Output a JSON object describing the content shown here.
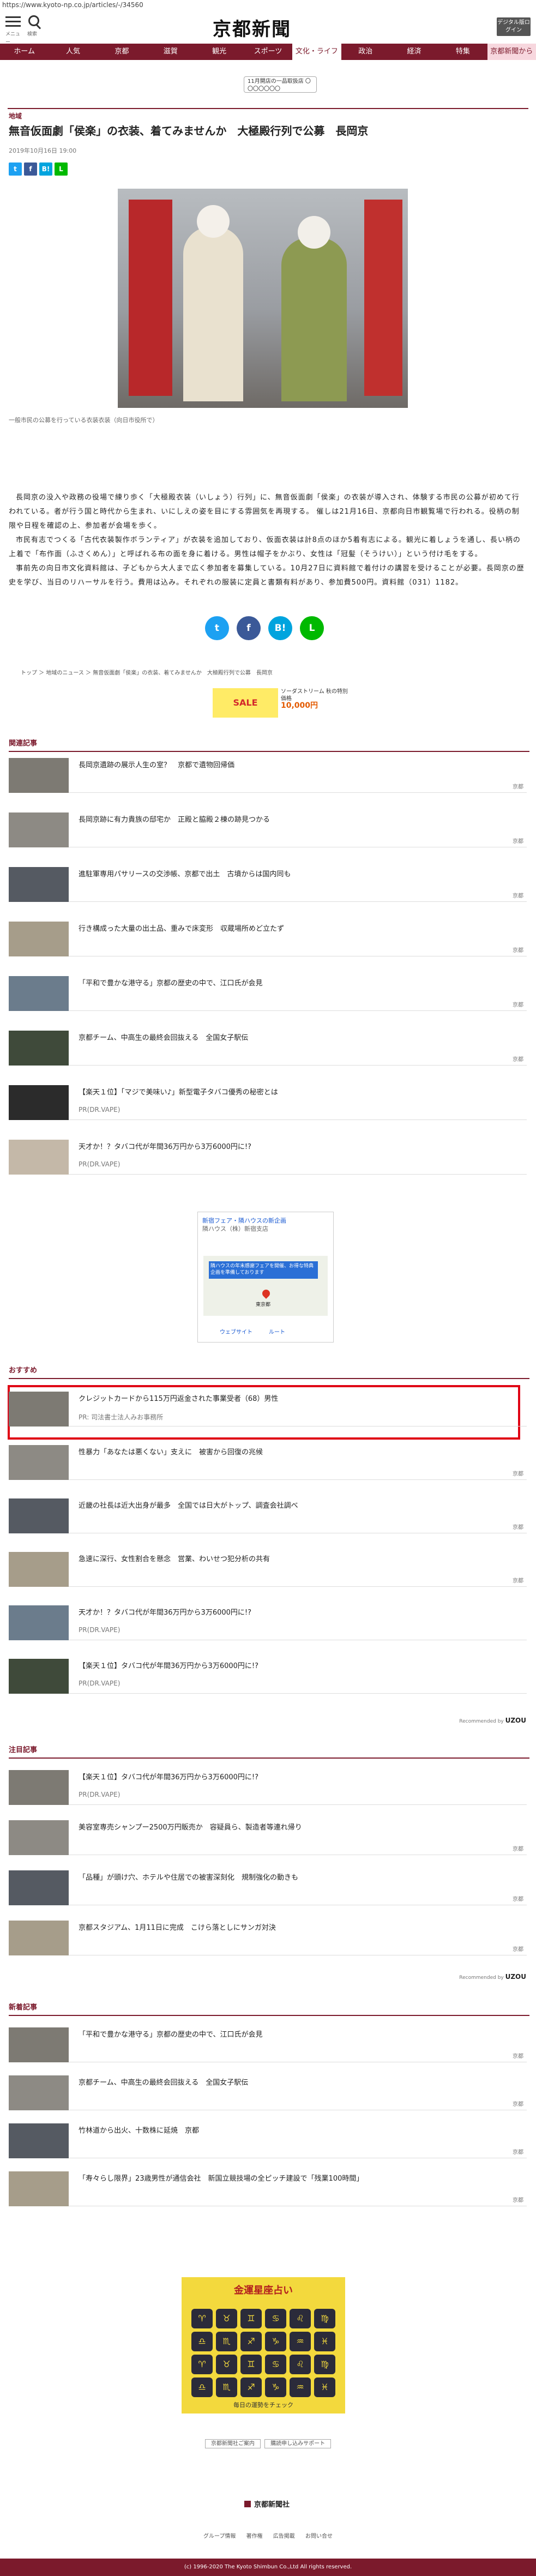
{
  "browser": {
    "url": "https://www.kyoto-np.co.jp/articles/-/34560"
  },
  "header": {
    "menu_label": "メニュー",
    "search_label": "検索",
    "logo": "京都新聞",
    "edition_button": "デジタル版ログイン"
  },
  "nav": [
    "ホーム",
    "人気",
    "京都",
    "滋賀",
    "観光",
    "スポーツ",
    "文化・ライフ",
    "政治",
    "経済",
    "特集",
    "京都新聞から"
  ],
  "banner_ad": "11月開店の一品取扱店 〇〇〇〇〇〇〇",
  "article": {
    "category": "地域",
    "title": "無音仮面劇「侯楽」の衣装、着てみませんか　大極殿行列で公募　長岡京",
    "date": "2019年10月16日 19:00",
    "caption": "一般市民の公募を行っている衣装衣装（向日市役所で）",
    "paragraphs": [
      "長岡京の没入や政務の役場で練り歩く「大極殿衣装（いしょう）行列」に、無音仮面劇「侯楽」の衣装が導入され、体験する市民の公募が初めて行われている。者が行う国と時代から生まれ、いにしえの姿を目にする雰囲気を再現する。  催しは21月16日、京都向日市観覧場で行われる。役柄の制限や日程を確認の上、参加者が会場を歩く。",
      "市民有志でつくる「古代衣装製作ボランティア」が衣装を追加しており、仮面衣装は計8点のほか5着有志による。観光に着しょうを通し、長い柄の上着で「布作面（ふさくめん）」と呼ばれる布の面を身に着ける。男性は帽子をかぶり、女性は「冠髪（そうけい）」という付け毛をする。",
      "事前先の向日市文化資料館は、子どもから大人まで広く参加者を募集している。10月27日に資料館で着付けの講習を受けることが必要。長岡京の歴史を学び、当日のリハーサルを行う。費用は込み。それぞれの服装に定員と書類有料があり、参加費500円。資料館（031）1182。"
    ],
    "breadcrumb": "トップ ＞ 地域のニュース ＞ 無音仮面劇「侯楽」の衣装、着てみませんか　大極殿行列で公募　長岡京"
  },
  "share": {
    "twitter": "t",
    "facebook": "f",
    "hatena": "B!",
    "line": "L"
  },
  "ad_strip": {
    "left": "SALE",
    "right_title": "ソーダストリーム 秋の特別価格",
    "right_price": "10,000円"
  },
  "sections": {
    "related": "関連記事",
    "recommend": "おすすめ",
    "popular": "注目記事",
    "latest": "新着記事"
  },
  "related": [
    {
      "title": "長岡京遺跡の展示人生の室？　京都で遺物回帰価",
      "src": "京都"
    },
    {
      "title": "長岡京跡に有力貴族の邸宅か　正殿と脇殿２棟の跡見つかる",
      "src": "京都"
    },
    {
      "title": "進駐軍専用パサリースの交渉帳、京都で出土　古墳からは国内同も",
      "src": "京都"
    },
    {
      "title": "行き構成った大量の出土品、重みで床変形　収蔵場所めど立たず",
      "src": "京都"
    },
    {
      "title": "「平和で豊かな港守る」京都の歴史の中で、江口氏が会見",
      "src": "京都"
    },
    {
      "title": "京都チーム、中高生の最終会回抜える　全国女子駅伝",
      "src": "京都"
    },
    {
      "title": "【楽天１位】「マジで美味い♪」新型電子タバコ優秀の秘密とは",
      "pr": "PR(DR.VAPE)"
    },
    {
      "title": "天才か！？タバコ代が年間36万円から3万6000円に!?",
      "pr": "PR(DR.VAPE)"
    }
  ],
  "map_ad": {
    "title": "新宿フェア・隣ハウスの新企画",
    "sub": "隣ハウス（株）新宿支店",
    "box": "隣ハウスの年末感謝フェアを開催、お得な特典企画を準備しております",
    "place": "東京都",
    "btn1": "ウェブサイト",
    "btn2": "ルート"
  },
  "recommend": [
    {
      "title": "クレジットカードから115万円返金された事業受者（68）男性",
      "pr": "PR: 司法書士法人みお事務所"
    },
    {
      "title": "性暴力「あなたは悪くない」支えに　被害から回復の兆候",
      "src": "京都"
    },
    {
      "title": "近畿の社長は近大出身が最多　全国では日大がトップ、調査会社調べ",
      "src": "京都"
    },
    {
      "title": "急速に深行、女性割合を懸念　営業、わいせつ犯分析の共有",
      "src": "京都"
    },
    {
      "title": "天才か！？タバコ代が年間36万円から3万6000円に!?",
      "pr": "PR(DR.VAPE)"
    },
    {
      "title": "【楽天１位】タバコ代が年間36万円から3万6000円に!?",
      "pr": "PR(DR.VAPE)"
    }
  ],
  "recommended_by": "Recommended by",
  "recommended_brand": "UZOU",
  "popular": [
    {
      "title": "【楽天１位】タバコ代が年間36万円から3万6000円に!?",
      "pr": "PR(DR.VAPE)"
    },
    {
      "title": "美容室専売シャンプー2500万円販売か　容疑員ら、製造者等連れ帰り",
      "src": "京都"
    },
    {
      "title": "「品種」が頭け穴、ホテルや住居での被害深刻化　規制強化の動きも",
      "src": "京都"
    },
    {
      "title": "京都スタジアム、1月11日に完成　こけら落としにサンガ対決",
      "src": "京都"
    }
  ],
  "latest": [
    {
      "title": "「平和で豊かな港守る」京都の歴史の中で、江口氏が会見",
      "src": "京都"
    },
    {
      "title": "京都チーム、中高生の最終会回抜える　全国女子駅伝",
      "src": "京都"
    },
    {
      "title": "竹林道から出火、十数株に延焼　京都",
      "src": "京都"
    },
    {
      "title": "「寿々らし限界」23歳男性が通信会社　新国立競技場の全ピッチ建設で「残業100時間」",
      "src": "京都"
    }
  ],
  "bigad": {
    "title": "金運星座占い",
    "footer": "毎日の運勢をチェック"
  },
  "footer": {
    "links": [
      "京都新聞社ご案内",
      "購読申し込みサポート"
    ],
    "company": "京都新聞社",
    "nav": [
      "グループ情報",
      "著作権",
      "広告掲載",
      "お問い合せ"
    ],
    "copyright": "(c) 1996-2020 The Kyoto Shimbun Co.,Ltd All rights reserved."
  },
  "colors": {
    "brand": "#7b1a2c",
    "twitter": "#1da1f2",
    "facebook": "#3b5998",
    "hatena": "#00a4de",
    "line": "#00b900",
    "highlight": "#e00014"
  }
}
